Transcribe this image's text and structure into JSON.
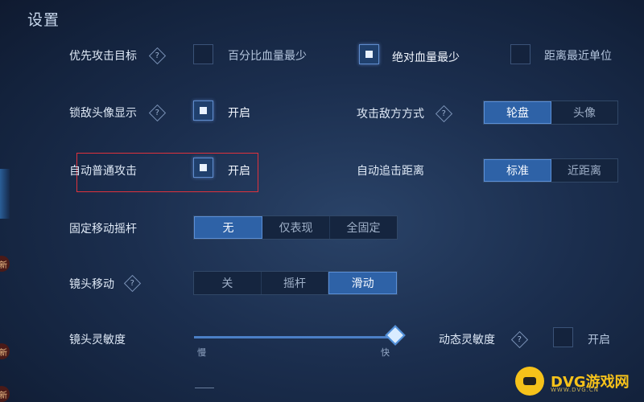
{
  "title": "设置",
  "priority_target": {
    "label": "优先攻击目标",
    "options": [
      {
        "label": "百分比血量最少",
        "checked": false
      },
      {
        "label": "绝对血量最少",
        "checked": true
      },
      {
        "label": "距离最近单位",
        "checked": false
      }
    ]
  },
  "lock_avatar": {
    "label": "锁敌头像显示",
    "option": "开启",
    "checked": true
  },
  "attack_mode": {
    "label": "攻击敌方方式",
    "segments": [
      "轮盘",
      "头像"
    ],
    "selected": "轮盘"
  },
  "auto_attack": {
    "label": "自动普通攻击",
    "option": "开启",
    "checked": true
  },
  "auto_chase": {
    "label": "自动追击距离",
    "segments": [
      "标准",
      "近距离"
    ],
    "selected": "标准"
  },
  "fixed_joystick": {
    "label": "固定移动摇杆",
    "segments": [
      "无",
      "仅表现",
      "全固定"
    ],
    "selected": "无"
  },
  "camera_move": {
    "label": "镜头移动",
    "segments": [
      "关",
      "摇杆",
      "滑动"
    ],
    "selected": "滑动"
  },
  "camera_sensitivity": {
    "label": "镜头灵敏度",
    "min_label": "慢",
    "max_label": "快",
    "value": 1.0
  },
  "dynamic_sensitivity": {
    "label": "动态灵敏度",
    "option": "开启",
    "checked": false
  },
  "side_badges": [
    "新",
    "新",
    "新"
  ],
  "watermark": {
    "text": "DVG游戏网",
    "sub": "WWW.DVG.CN"
  },
  "colors": {
    "accent": "#2e62a7",
    "highlight_box": "#e0323c",
    "watermark": "#f6c21a"
  }
}
